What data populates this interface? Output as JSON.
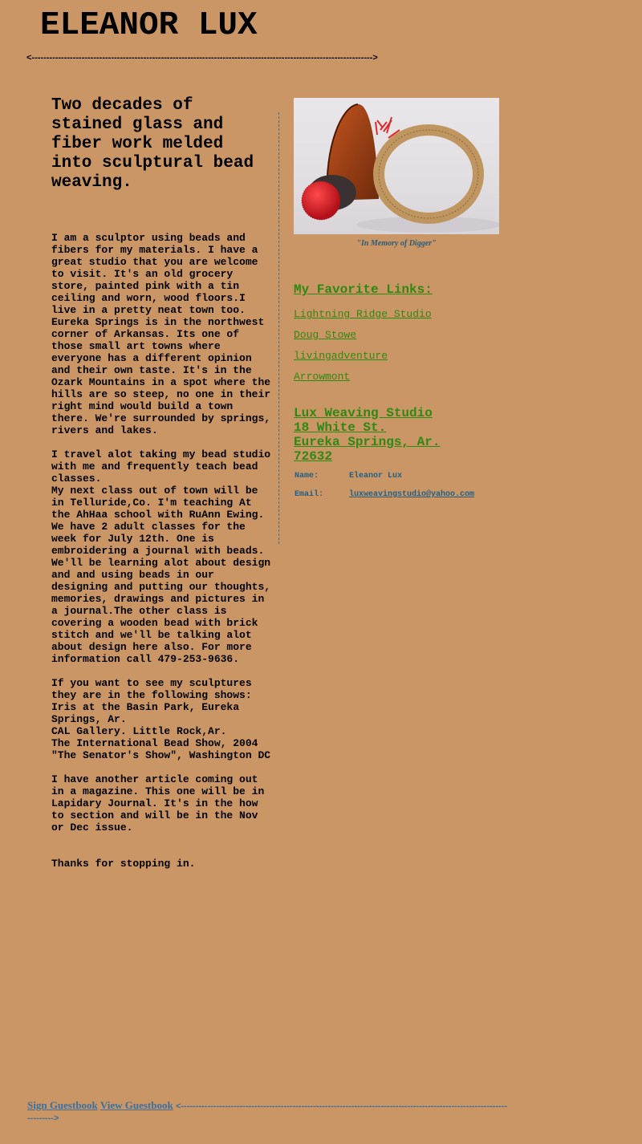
{
  "header": {
    "title": "ELEANOR LUX",
    "rule": "<-------------------------------------------------------------------------------------------------------------------->"
  },
  "main": {
    "tagline": "Two decades of stained glass and fiber work melded into sculptural bead weaving.",
    "paragraphs": [
      "I am a sculptor using beads and fibers for my materials. I have a great studio that you are welcome to visit. It's an old grocery store, painted pink with a tin ceiling and worn, wood floors.I live in a pretty neat town too. Eureka Springs is in the northwest corner of Arkansas. Its one of those small art towns where everyone has a different opinion and their own taste. It's in the Ozark Mountains in a spot where the hills are so steep, no one in their right mind would build a town there. We're surrounded by springs, rivers and lakes.",
      "I travel alot taking my bead studio with me and frequently teach bead classes.\nMy next class out of town will be in Telluride,Co. I'm teaching At the AhHaa school with RuAnn Ewing. We have 2 adult classes for the week for July 12th. One is embroidering a journal with beads. We'll be learning alot about design and and using beads in our designing and putting our thoughts, memories, drawings and pictures in a journal.The other class is covering a wooden bead with brick stitch and we'll be talking alot about design here also. For more information call 479-253-9636.",
      "If you want to see my sculptures they are in the following shows:\nIris at the Basin Park, Eureka Springs, Ar.\nCAL Gallery. Little Rock,Ar.\nThe International Bead Show, 2004\n\"The Senator's Show\", Washington DC",
      "I have another article coming out in a magazine. This one will be in Lapidary Journal. It's in the how to section and will be in the Nov or Dec issue.",
      "Thanks for stopping in."
    ]
  },
  "sidebar": {
    "image_caption": "\"In Memory of Digger\"",
    "links_heading": "My Favorite Links:",
    "links": [
      "Lightning Ridge Studio",
      "Doug Stowe",
      "livingadventure",
      "Arrowmont"
    ],
    "studio": {
      "name": "Lux Weaving Studio",
      "street": "18 White St.",
      "city": "Eureka Springs, Ar.",
      "zip": "72632"
    },
    "contact": {
      "name_label": "Name:",
      "name_value": "Eleanor Lux",
      "email_label": "Email:",
      "email_value": "luxweavingstudio@yahoo.com"
    }
  },
  "footer": {
    "sign_guestbook": "Sign Guestbook",
    "view_guestbook": "View Guestbook",
    "rule": "<------------------------------------------------------------------------------------------------------------------------>"
  },
  "colors": {
    "background": "#cb9665",
    "link_green": "#2c8a12",
    "link_blue": "#3a6fa0",
    "divider": "#3f6f8a"
  }
}
